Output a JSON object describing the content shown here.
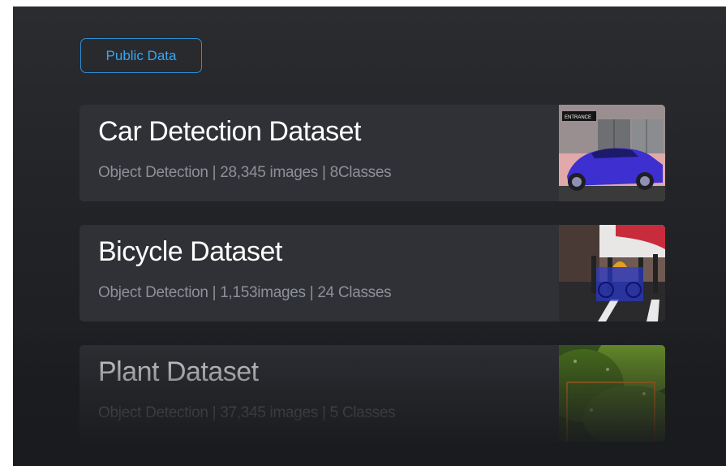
{
  "filter": {
    "label": "Public Data"
  },
  "datasets": [
    {
      "title": "Car Detection Dataset",
      "meta": "Object Detection | 28,345 images | 8Classes",
      "thumb_icon": "car-thumbnail",
      "thumb_sign": "ENTRANCE"
    },
    {
      "title": "Bicycle Dataset",
      "meta": "Object Detection | 1,153images | 24 Classes",
      "thumb_icon": "bicycle-thumbnail"
    },
    {
      "title": "Plant Dataset",
      "meta": "Object Detection | 37,345 images | 5 Classes",
      "thumb_icon": "plant-thumbnail"
    }
  ],
  "colors": {
    "accent": "#2e8fd6",
    "card_bg": "#2f3136",
    "bbox_blue": "#2a3ad8",
    "bbox_orange": "#d88a1a"
  }
}
